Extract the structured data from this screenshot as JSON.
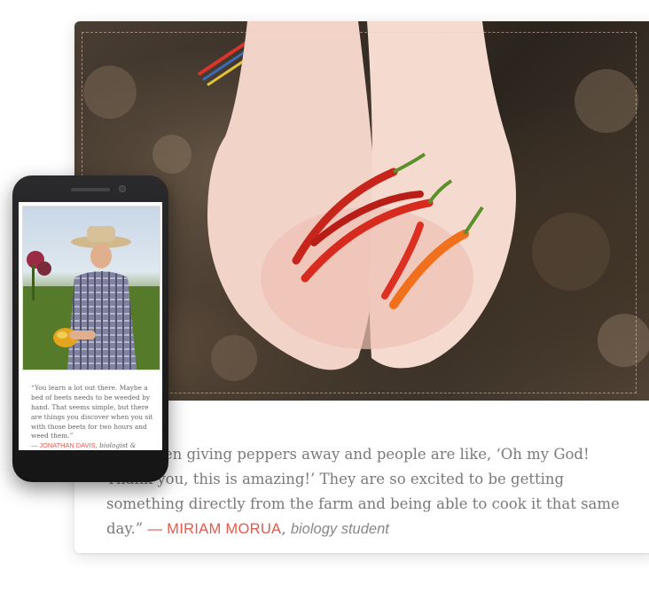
{
  "testimonial": {
    "quote": "“I’ve been giving peppers away and people are like, ‘Oh my God! Thank you, this is amazing!’ They are so excited to be getting something directly from the farm and being able to cook it that same day.”",
    "author_prefix": "— ",
    "author": "MIRIAM MORUA",
    "separator": ", ",
    "role": "biology student"
  },
  "mobile_testimonial": {
    "quote": "“You learn a lot out there. Maybe a bed of beets needs to be weeded by hand. That seems simple, but there are things you discover when you sit with those beets for two hours and weed them.”",
    "author_prefix": "— ",
    "author": "JONATHAN DAVIS",
    "separator": ", ",
    "role": "biologist &"
  },
  "colors": {
    "accent": "#e8574a",
    "body_text": "#7a7a7a"
  }
}
